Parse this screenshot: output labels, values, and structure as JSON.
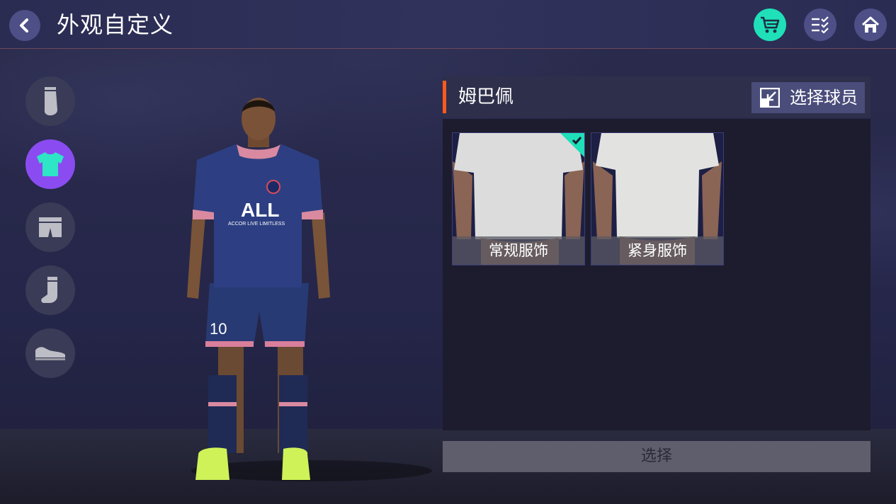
{
  "header": {
    "title": "外观自定义"
  },
  "icons": {
    "back": "back-arrow-icon",
    "cart": "shopping-cart-icon",
    "checklist": "checklist-icon",
    "home": "home-icon"
  },
  "categories": [
    {
      "name": "sleeve",
      "icon": "sleeve-icon",
      "active": false
    },
    {
      "name": "shirt",
      "icon": "shirt-icon",
      "active": true
    },
    {
      "name": "shorts",
      "icon": "shorts-icon",
      "active": false
    },
    {
      "name": "sock",
      "icon": "sock-icon",
      "active": false
    },
    {
      "name": "boot",
      "icon": "boot-icon",
      "active": false
    }
  ],
  "panel": {
    "player_name": "姆巴佩",
    "select_player_label": "选择球员"
  },
  "outfits": [
    {
      "label": "常规服饰",
      "selected": true
    },
    {
      "label": "紧身服饰",
      "selected": false
    }
  ],
  "select_button": "选择",
  "player_figure": {
    "shirt_text": "ALL",
    "shirt_subtext": "ACCOR LIVE LIMITLESS",
    "number": "10"
  },
  "colors": {
    "accent_green": "#1fe0b8",
    "active_purple": "#8a4cf0",
    "header_accent": "#ff5a1e"
  }
}
